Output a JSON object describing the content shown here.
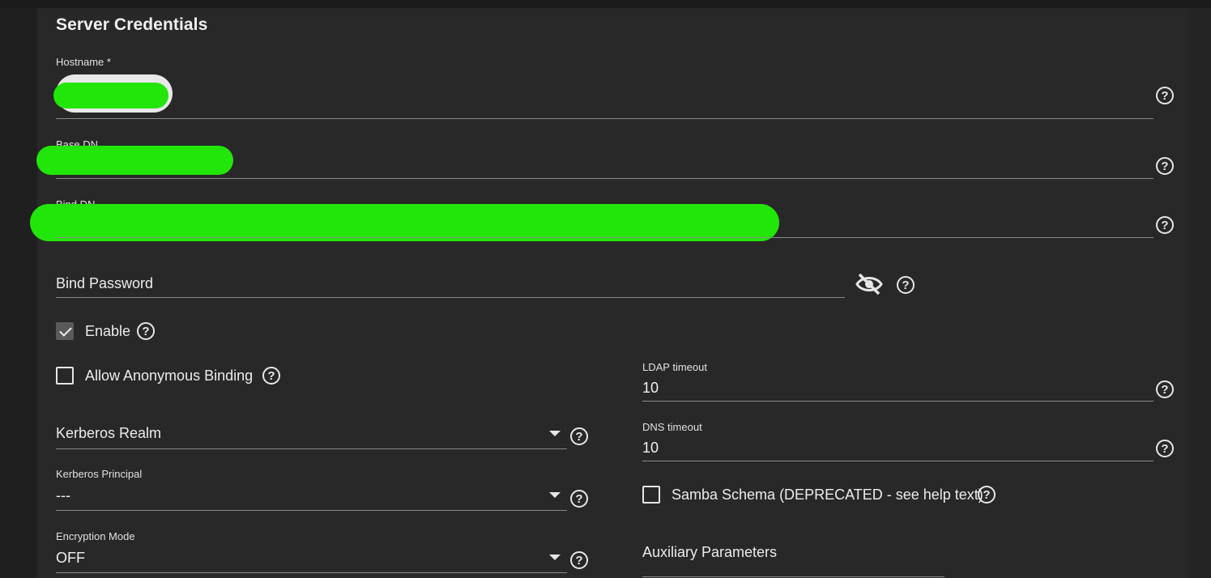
{
  "section": {
    "title": "Server Credentials"
  },
  "fields": {
    "hostname": {
      "label": "Hostname *"
    },
    "base_dn": {
      "label": "Base DN"
    },
    "bind_dn": {
      "label": "Bind DN"
    },
    "bind_password": {
      "label": "Bind Password"
    },
    "enable": {
      "label": "Enable",
      "checked": true
    },
    "allow_anonymous": {
      "label": "Allow Anonymous Binding",
      "checked": false
    },
    "ldap_timeout": {
      "label": "LDAP timeout",
      "value": "10"
    },
    "dns_timeout": {
      "label": "DNS timeout",
      "value": "10"
    },
    "kerberos_realm": {
      "label": "Kerberos Realm"
    },
    "kerberos_principal": {
      "label": "Kerberos Principal",
      "value": "---"
    },
    "samba_schema": {
      "label": "Samba Schema (DEPRECATED - see help text)",
      "checked": false
    },
    "encryption_mode": {
      "label": "Encryption Mode",
      "value": "OFF"
    },
    "auxiliary_parameters": {
      "label": "Auxiliary Parameters"
    }
  },
  "icons": {
    "help": "help-circle-icon",
    "visibility": "eye-off-icon",
    "dropdown": "caret-down-icon"
  },
  "colors": {
    "background": "#282828",
    "redaction": "#22e60a"
  }
}
